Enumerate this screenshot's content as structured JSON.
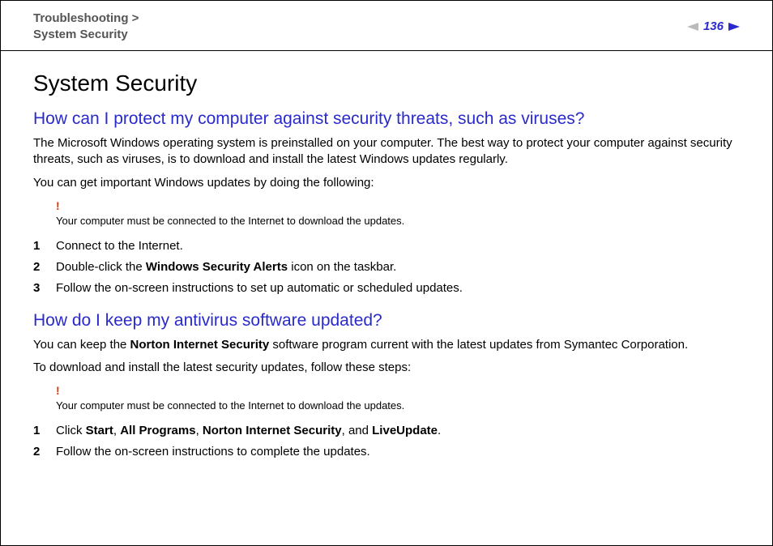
{
  "header": {
    "breadcrumb_line1": "Troubleshooting >",
    "breadcrumb_line2": "System Security",
    "page_number": "136"
  },
  "title": "System Security",
  "section1": {
    "heading": "How can I protect my computer against security threats, such as viruses?",
    "para1": "The Microsoft Windows operating system is preinstalled on your computer. The best way to protect your computer against security threats, such as viruses, is to download and install the latest Windows updates regularly.",
    "para2": "You can get important Windows updates by doing the following:",
    "note_bang": "!",
    "note": "Your computer must be connected to the Internet to download the updates.",
    "steps": {
      "n1": "1",
      "s1": "Connect to the Internet.",
      "n2": "2",
      "s2a": "Double-click the ",
      "s2b": "Windows Security Alerts",
      "s2c": " icon on the taskbar.",
      "n3": "3",
      "s3": "Follow the on-screen instructions to set up automatic or scheduled updates."
    }
  },
  "section2": {
    "heading": "How do I keep my antivirus software updated?",
    "para1a": "You can keep the ",
    "para1b": "Norton Internet Security",
    "para1c": " software program current with the latest updates from Symantec Corporation.",
    "para2": "To download and install the latest security updates, follow these steps:",
    "note_bang": "!",
    "note": "Your computer must be connected to the Internet to download the updates.",
    "steps": {
      "n1": "1",
      "s1a": "Click ",
      "s1b": "Start",
      "s1c": ", ",
      "s1d": "All Programs",
      "s1e": ", ",
      "s1f": "Norton Internet Security",
      "s1g": ", and ",
      "s1h": "LiveUpdate",
      "s1i": ".",
      "n2": "2",
      "s2": "Follow the on-screen instructions to complete the updates."
    }
  }
}
